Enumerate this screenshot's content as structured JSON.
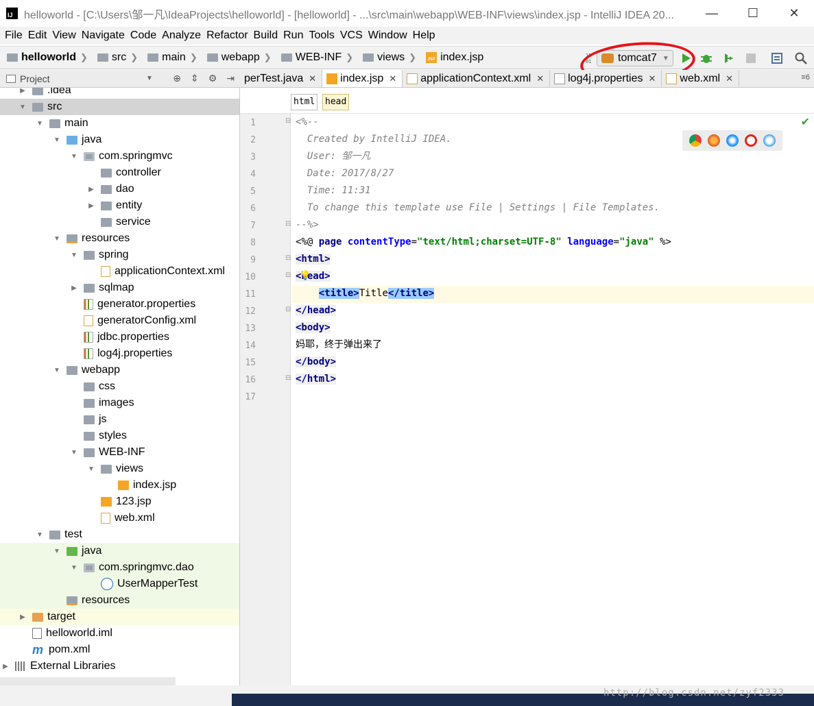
{
  "window": {
    "title": "helloworld - [C:\\Users\\邹一凡\\IdeaProjects\\helloworld] - [helloworld] - ...\\src\\main\\webapp\\WEB-INF\\views\\index.jsp - IntelliJ IDEA 20...",
    "minimize": "—",
    "maximize": "☐",
    "close": "✕"
  },
  "menu": [
    "File",
    "Edit",
    "View",
    "Navigate",
    "Code",
    "Analyze",
    "Refactor",
    "Build",
    "Run",
    "Tools",
    "VCS",
    "Window",
    "Help"
  ],
  "breadcrumb": [
    "helloworld",
    "src",
    "main",
    "webapp",
    "WEB-INF",
    "views",
    "index.jsp"
  ],
  "run_config": {
    "label": "tomcat7",
    "highlight_color": "#e3141b"
  },
  "project_panel": {
    "title": "Project"
  },
  "tree": [
    {
      "label": ".idea",
      "depth": 1,
      "icon": "folder",
      "toggle": "collapsed"
    },
    {
      "label": "src",
      "depth": 1,
      "icon": "folder",
      "toggle": "expanded",
      "selected": true
    },
    {
      "label": "main",
      "depth": 2,
      "icon": "folder",
      "toggle": "expanded"
    },
    {
      "label": "java",
      "depth": 3,
      "icon": "blue",
      "toggle": "expanded"
    },
    {
      "label": "com.springmvc",
      "depth": 4,
      "icon": "pkg",
      "toggle": "expanded"
    },
    {
      "label": "controller",
      "depth": 5,
      "icon": "folder",
      "toggle": ""
    },
    {
      "label": "dao",
      "depth": 5,
      "icon": "folder",
      "toggle": "collapsed"
    },
    {
      "label": "entity",
      "depth": 5,
      "icon": "folder",
      "toggle": "collapsed"
    },
    {
      "label": "service",
      "depth": 5,
      "icon": "folder",
      "toggle": ""
    },
    {
      "label": "resources",
      "depth": 3,
      "icon": "res",
      "toggle": "expanded"
    },
    {
      "label": "spring",
      "depth": 4,
      "icon": "folder",
      "toggle": "expanded"
    },
    {
      "label": "applicationContext.xml",
      "depth": 5,
      "icon": "xml",
      "toggle": ""
    },
    {
      "label": "sqlmap",
      "depth": 4,
      "icon": "folder",
      "toggle": "collapsed"
    },
    {
      "label": "generator.properties",
      "depth": 4,
      "icon": "prop",
      "toggle": ""
    },
    {
      "label": "generatorConfig.xml",
      "depth": 4,
      "icon": "xml",
      "toggle": ""
    },
    {
      "label": "jdbc.properties",
      "depth": 4,
      "icon": "prop",
      "toggle": ""
    },
    {
      "label": "log4j.properties",
      "depth": 4,
      "icon": "prop",
      "toggle": ""
    },
    {
      "label": "webapp",
      "depth": 3,
      "icon": "folder",
      "toggle": "expanded"
    },
    {
      "label": "css",
      "depth": 4,
      "icon": "folder",
      "toggle": ""
    },
    {
      "label": "images",
      "depth": 4,
      "icon": "folder",
      "toggle": ""
    },
    {
      "label": "js",
      "depth": 4,
      "icon": "folder",
      "toggle": ""
    },
    {
      "label": "styles",
      "depth": 4,
      "icon": "folder",
      "toggle": ""
    },
    {
      "label": "WEB-INF",
      "depth": 4,
      "icon": "folder",
      "toggle": "expanded"
    },
    {
      "label": "views",
      "depth": 5,
      "icon": "folder",
      "toggle": "expanded"
    },
    {
      "label": "index.jsp",
      "depth": 6,
      "icon": "jsp",
      "toggle": ""
    },
    {
      "label": "123.jsp",
      "depth": 5,
      "icon": "jsp",
      "toggle": ""
    },
    {
      "label": "web.xml",
      "depth": 5,
      "icon": "xml",
      "toggle": ""
    },
    {
      "label": "test",
      "depth": 2,
      "icon": "folder",
      "toggle": "expanded"
    },
    {
      "label": "java",
      "depth": 3,
      "icon": "green",
      "toggle": "expanded",
      "green": true
    },
    {
      "label": "com.springmvc.dao",
      "depth": 4,
      "icon": "pkg",
      "toggle": "expanded",
      "green": true
    },
    {
      "label": "UserMapperTest",
      "depth": 5,
      "icon": "cls",
      "toggle": "",
      "green": true
    },
    {
      "label": "resources",
      "depth": 3,
      "icon": "res",
      "toggle": "",
      "green": true
    },
    {
      "label": "target",
      "depth": 1,
      "icon": "orange",
      "toggle": "collapsed",
      "yellow": true
    },
    {
      "label": "helloworld.iml",
      "depth": 1,
      "icon": "iml",
      "toggle": ""
    },
    {
      "label": "pom.xml",
      "depth": 1,
      "icon": "mvn",
      "toggle": ""
    },
    {
      "label": "External Libraries",
      "depth": 0,
      "icon": "lib",
      "toggle": "collapsed"
    }
  ],
  "tabs": [
    {
      "label": "perTest.java",
      "active": false
    },
    {
      "label": "index.jsp",
      "active": true
    },
    {
      "label": "applicationContext.xml",
      "active": false
    },
    {
      "label": "log4j.properties",
      "active": false
    },
    {
      "label": "web.xml",
      "active": false
    }
  ],
  "tab_overflow": "≡6",
  "tag_path": [
    "html",
    "head"
  ],
  "editor": {
    "line_numbers": [
      "1",
      "2",
      "3",
      "4",
      "5",
      "6",
      "7",
      "8",
      "9",
      "10",
      "11",
      "12",
      "13",
      "14",
      "15",
      "16",
      "17"
    ],
    "lines": [
      "<%--",
      "  Created by IntelliJ IDEA.",
      "  User: 邹一凡",
      "  Date: 2017/8/27",
      "  Time: 11:31",
      "  To change this template use File | Settings | File Templates.",
      "--%>",
      "<%@ page contentType=\"text/html;charset=UTF-8\" language=\"java\" %>",
      "<html>",
      "<head>",
      "    <title>Title</title>",
      "</head>",
      "<body>",
      "妈耶，终于弹出来了",
      "</body>",
      "</html>",
      ""
    ]
  },
  "watermark": "http://blog.csdn.net/zyf2333"
}
